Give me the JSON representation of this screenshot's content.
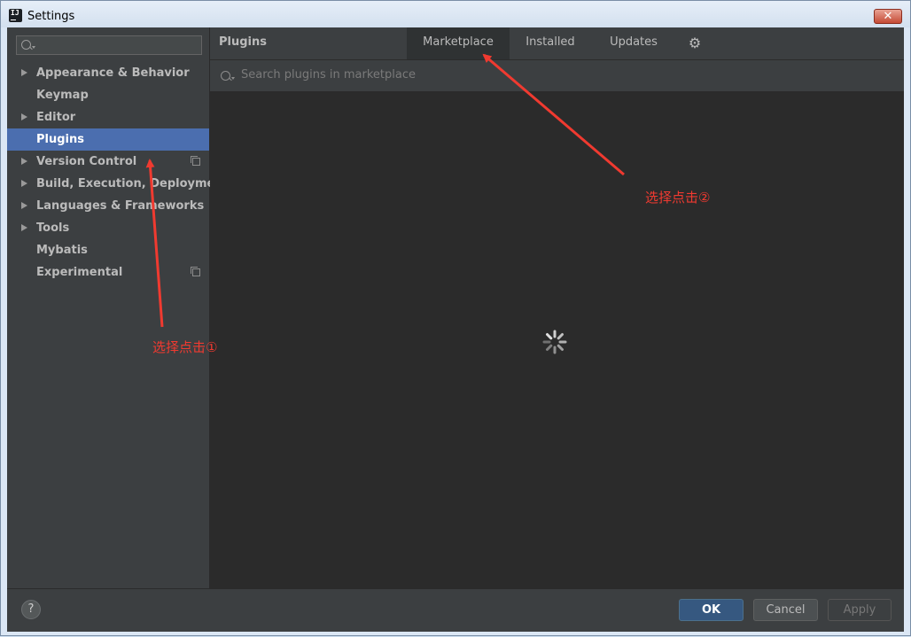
{
  "window": {
    "title": "Settings",
    "close_symbol": "✕",
    "app_icon_text": "IJ"
  },
  "sidebar": {
    "search_placeholder": "",
    "items": [
      {
        "label": "Appearance & Behavior",
        "expandable": true,
        "copy_icon": false,
        "selected": false
      },
      {
        "label": "Keymap",
        "expandable": false,
        "copy_icon": false,
        "selected": false
      },
      {
        "label": "Editor",
        "expandable": true,
        "copy_icon": false,
        "selected": false
      },
      {
        "label": "Plugins",
        "expandable": false,
        "copy_icon": false,
        "selected": true
      },
      {
        "label": "Version Control",
        "expandable": true,
        "copy_icon": true,
        "selected": false
      },
      {
        "label": "Build, Execution, Deployment",
        "expandable": true,
        "copy_icon": false,
        "selected": false
      },
      {
        "label": "Languages & Frameworks",
        "expandable": true,
        "copy_icon": false,
        "selected": false
      },
      {
        "label": "Tools",
        "expandable": true,
        "copy_icon": false,
        "selected": false
      },
      {
        "label": "Mybatis",
        "expandable": false,
        "copy_icon": false,
        "selected": false
      },
      {
        "label": "Experimental",
        "expandable": false,
        "copy_icon": true,
        "selected": false
      }
    ]
  },
  "main": {
    "title": "Plugins",
    "tabs": [
      {
        "label": "Marketplace",
        "active": true
      },
      {
        "label": "Installed",
        "active": false
      },
      {
        "label": "Updates",
        "active": false
      }
    ],
    "gear_symbol": "⚙",
    "search_placeholder": "Search plugins in marketplace"
  },
  "footer": {
    "help_label": "?",
    "ok_label": "OK",
    "cancel_label": "Cancel",
    "apply_label": "Apply"
  },
  "annotations": {
    "step1": "选择点击①",
    "step2": "选择点击②",
    "color": "#f03a30"
  },
  "colors": {
    "selection": "#4b6eaf",
    "panel": "#3c3f41",
    "content": "#2b2b2b",
    "ok_button": "#365880"
  }
}
